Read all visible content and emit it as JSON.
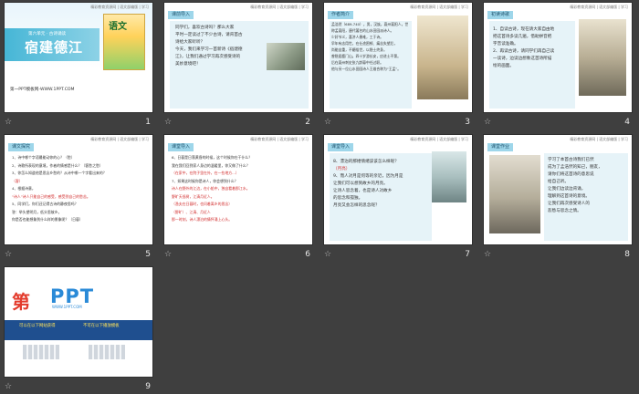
{
  "header_text": "精彩教育资源网 | 语文部编版 | 学习",
  "star_glyph": "☆",
  "slides": [
    {
      "num": "1",
      "sub": "第六单元 · 古诗诵读",
      "title": "宿建德江",
      "book": "语文",
      "footer": "第一PPT模板网-WWW.1PPT.COM"
    },
    {
      "num": "2",
      "tag": "课前导入",
      "lines": [
        "同学们，喜欢古诗吗？那么大家",
        "平时一定读过了不少古诗，请背首古",
        "诗给大家听听？",
        "今天，我们来学习一首新诗《宿建德",
        "江》，让我们通过学习再次感受诗的",
        "美妙意境吧！"
      ]
    },
    {
      "num": "3",
      "tag": "作者简介",
      "lines": [
        "孟浩然（689-740），男，汉族，襄州襄阳人，世",
        "称孟襄阳，唐代著名的山水田园派诗人。",
        "少好节义，喜济人患难，工于诗。",
        "早年有志用世，在仕途困顿、痛苦失望后，",
        "尚能自重，不媚俗世，以隐士终身。",
        "曾隐居鹿门山。四十岁游长安，应进士不第。",
        "后在襄州刺史张九龄幕中任过职。",
        "他与另一位山水田园诗人王维合称为“王孟”。"
      ]
    },
    {
      "num": "4",
      "tag": "初读诗歌",
      "lines": [
        "1、自读古诗，现在请大家自由地",
        "把这首诗多读几遍，借助拼音把",
        "字音读准确。",
        "2、再读古诗，请同学们再自己读",
        "一读诗，边读边想象这首诗所描",
        "绘的画面。"
      ]
    },
    {
      "num": "5",
      "tag": "课文探究",
      "lines": [
        "1、诗中哪个字语最能动你的心？（愁）",
        "2、诗歌所表现的意境，作者的情感是什么？（客愁之愁）",
        "3、你怎么知道他是思念乡愁的？从诗中哪一个字看出来的？",
        "（客）",
        "4、根据诗意，",
        "“诗人”诗人只能自己的感受，感受到自己的愁苦。",
        "5、同学们，你们还记得古诗的静夜思吗？",
        "答：举头望明月，低头思故乡。",
        "你是否也能想象到什么样的景象呢？（日暮）"
      ]
    },
    {
      "num": "6",
      "tag": "课堂导入",
      "lines": [
        "6、日暮是日落黄昏的时候，这个时候你在干什么？",
        "我在我们回到家人身边的温暖里，你又做了什么？",
        "（在家中，在院子里在外，在一些地方...）",
        "7、如果这时候你是诗人，你会想到什么？",
        "诗人在野外的江边，在小船中，独自看着那江水。",
        "野旷天低树，江清月近人。",
        "（渔夫在日暮时，也问着离乡的思念）",
        "（野旷）、江清、月近人",
        "那一时刻，诗人漂泊的情怀涌上心头。"
      ]
    },
    {
      "num": "7",
      "tag": "课堂导入",
      "lines": [
        "8、漂泊的那缕情绪该该怎么样呢？",
        "（月亮）",
        "9、而人对月是何等的亲近，因为月是",
        "让我们可以想到故乡的月亮。",
        "让诗人思念着，也是诗人对故乡",
        "的思念和孤独。",
        "月亮又会怎样的思念呢？"
      ]
    },
    {
      "num": "8",
      "tag": "课堂作业",
      "lines": [
        "学习了本首古诗我们已然",
        "成为了孟浩然的知己，朋友，",
        "请你们将这首诗的意思说",
        "给自己听。",
        "让我们边读边背诵，",
        "理解到这首诗的意境。",
        "让我们再次感受诗人的",
        "悲愁与思念之情。"
      ]
    },
    {
      "num": "9",
      "logo_di": "第",
      "logo_ppt": "PPT",
      "logo_sub": "WWW.1PPT.COM",
      "bar_left": "可以在以下网站获得",
      "bar_right": "不可在以下播放模板"
    }
  ]
}
